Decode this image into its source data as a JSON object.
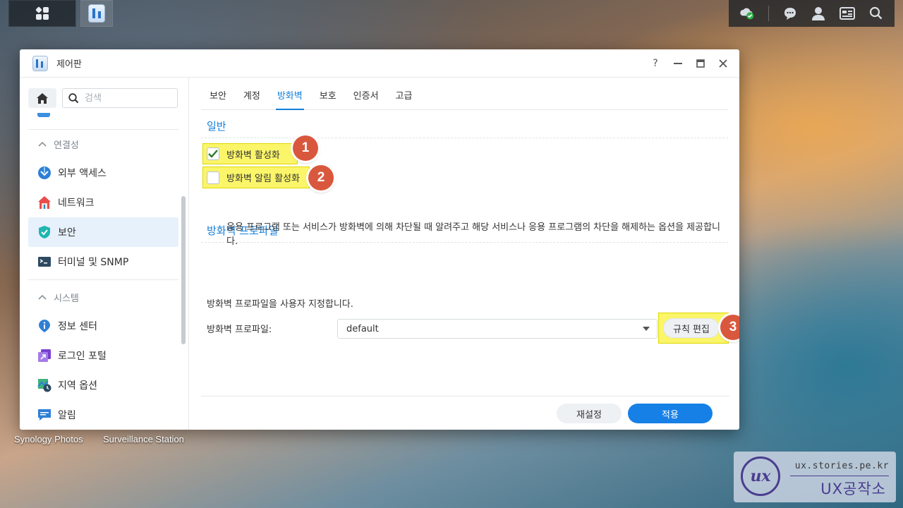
{
  "window": {
    "title": "제어판",
    "help": "?"
  },
  "sidebar": {
    "search_placeholder": "검색",
    "sections": [
      {
        "label": "연결성",
        "items": [
          {
            "label": "외부 액세스",
            "icon": "external-access-icon"
          },
          {
            "label": "네트워크",
            "icon": "network-icon"
          },
          {
            "label": "보안",
            "icon": "security-shield-icon",
            "active": true
          },
          {
            "label": "터미널 및 SNMP",
            "icon": "terminal-icon"
          }
        ]
      },
      {
        "label": "시스템",
        "items": [
          {
            "label": "정보 센터",
            "icon": "info-center-icon"
          },
          {
            "label": "로그인 포털",
            "icon": "login-portal-icon"
          },
          {
            "label": "지역 옵션",
            "icon": "regional-options-icon"
          },
          {
            "label": "알림",
            "icon": "notification-icon"
          }
        ]
      }
    ]
  },
  "tabs": [
    "보안",
    "계정",
    "방화벽",
    "보호",
    "인증서",
    "고급"
  ],
  "active_tab": "방화벽",
  "general": {
    "title": "일반",
    "enable_firewall": {
      "label": "방화벽 활성화",
      "checked": true
    },
    "enable_notification": {
      "label": "방화벽 알림 활성화",
      "checked": false
    },
    "description": "응용 프로그램 또는 서비스가 방화벽에 의해 차단될 때 알려주고 해당 서비스나 응용 프로그램의 차단을 해제하는 옵션을 제공합니다."
  },
  "profile": {
    "title": "방화벽 프로파일",
    "description": "방화벽 프로파일을 사용자 지정합니다.",
    "label": "방화벽 프로파일:",
    "value": "default",
    "edit_rules": "규칙 편집"
  },
  "footer": {
    "reset": "재설정",
    "apply": "적용"
  },
  "badges": [
    "1",
    "2",
    "3"
  ],
  "desktop": {
    "apps": [
      "Synology Photos",
      "Surveillance Station"
    ]
  },
  "watermark": {
    "url": "ux.stories.pe.kr",
    "name": "UX공작소",
    "logo": "ux"
  },
  "colors": {
    "accent": "#1680d8",
    "highlight": "#fbf56a",
    "badge": "#d9583d"
  }
}
